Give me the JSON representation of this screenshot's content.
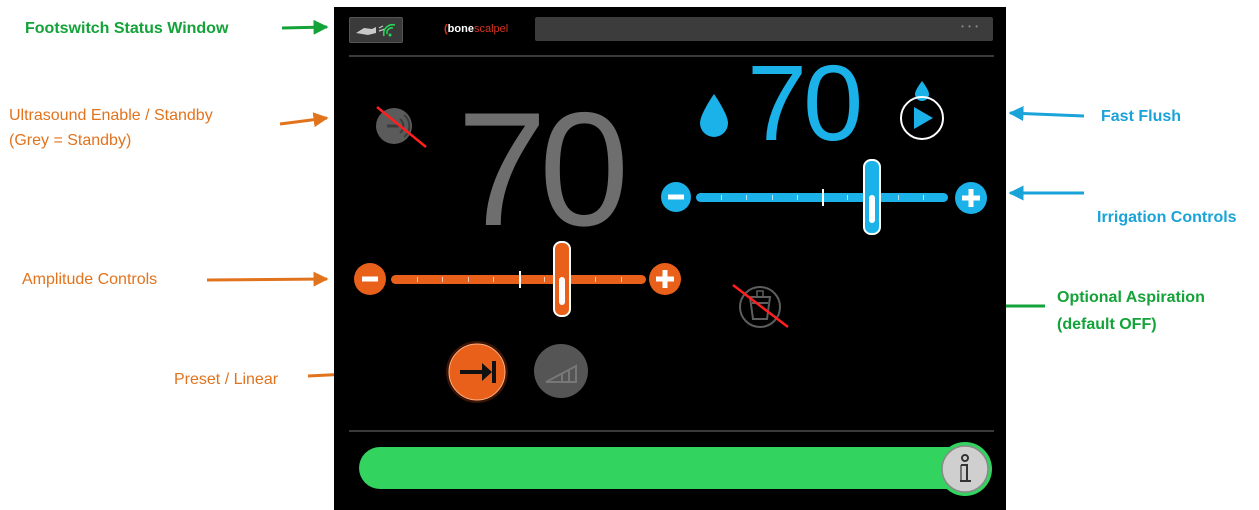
{
  "annotations": {
    "footswitch": "Footswitch Status Window",
    "ultrasound_line1": "Ultrasound Enable / Standby",
    "ultrasound_line2": "(Grey = Standby)",
    "amplitude": "Amplitude Controls",
    "preset": "Preset / Linear",
    "fast_flush": "Fast Flush",
    "irrigation": "Irrigation Controls",
    "aspiration_line1": "Optional Aspiration",
    "aspiration_line2": "(default OFF)"
  },
  "status_bar": {
    "logo_bone": "bone",
    "logo_scalpel": "scalpel",
    "menu_dots": "• • •"
  },
  "amplitude": {
    "value": "70",
    "slider_level": 0.67,
    "tick_count": 9
  },
  "irrigation": {
    "value": "70",
    "slider_level": 0.7,
    "tick_count": 9
  },
  "modes": {
    "preset_active": true,
    "linear_active": false
  },
  "ultrasound": {
    "state": "standby"
  },
  "aspiration": {
    "state": "off"
  },
  "colors": {
    "amplitude_accent": "#e8601a",
    "irrigation_accent": "#1ab2e8",
    "standby_grey": "#5a5a5a",
    "progress_green": "#33d35f",
    "callout_green": "#13a338",
    "callout_orange": "#e2731d",
    "callout_blue": "#1aa3d8"
  },
  "icons": {
    "footswitch": "footswitch-wireless-icon",
    "ultrasound": "ultrasound-standby-icon",
    "droplet": "droplet-icon",
    "fast_flush": "fast-flush-play-icon",
    "aspiration": "aspiration-canister-off-icon",
    "preset": "preset-arrow-icon",
    "linear": "linear-ramp-icon",
    "info": "info-icon"
  }
}
